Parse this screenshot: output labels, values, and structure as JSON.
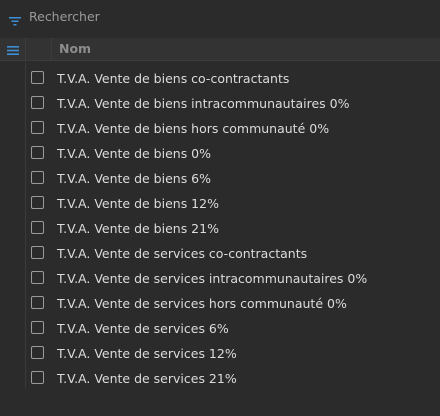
{
  "search": {
    "placeholder": "Rechercher",
    "value": ""
  },
  "table": {
    "column_name": "Nom",
    "rows": [
      {
        "label": "T.V.A. Vente de biens co-contractants",
        "checked": false
      },
      {
        "label": "T.V.A. Vente de biens intracommunautaires 0%",
        "checked": false
      },
      {
        "label": "T.V.A. Vente de biens hors communauté 0%",
        "checked": false
      },
      {
        "label": "T.V.A. Vente de biens 0%",
        "checked": false
      },
      {
        "label": "T.V.A. Vente de biens 6%",
        "checked": false
      },
      {
        "label": "T.V.A. Vente de biens 12%",
        "checked": false
      },
      {
        "label": "T.V.A. Vente de biens 21%",
        "checked": false
      },
      {
        "label": "T.V.A. Vente de services co-contractants",
        "checked": false
      },
      {
        "label": "T.V.A. Vente de services intracommunautaires 0%",
        "checked": false
      },
      {
        "label": "T.V.A. Vente de services hors communauté 0%",
        "checked": false
      },
      {
        "label": "T.V.A. Vente de services 6%",
        "checked": false
      },
      {
        "label": "T.V.A. Vente de services 12%",
        "checked": false
      },
      {
        "label": "T.V.A. Vente de services 21%",
        "checked": false
      }
    ]
  },
  "icons": {
    "filter": "filter-icon",
    "menu": "hamburger-menu-icon"
  },
  "colors": {
    "accent": "#3d8fd6",
    "background": "#2b2b2b",
    "text": "#dcdcdc"
  }
}
